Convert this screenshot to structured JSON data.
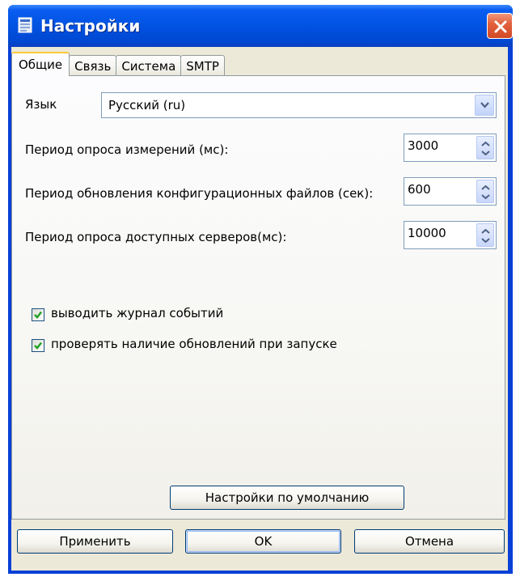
{
  "window": {
    "title": "Настройки"
  },
  "tabs": [
    {
      "label": "Общие",
      "active": true
    },
    {
      "label": "Связь",
      "active": false
    },
    {
      "label": "Система",
      "active": false
    },
    {
      "label": "SMTP",
      "active": false
    }
  ],
  "general": {
    "language_label": "Язык",
    "language_value": "Русский (ru)",
    "measure_period_label": "Период опроса измерений (мс):",
    "measure_period_value": "3000",
    "config_period_label": "Период обновления конфигурационных файлов (сек):",
    "config_period_value": "600",
    "servers_period_label": "Период опроса доступных серверов(мс):",
    "servers_period_value": "10000",
    "log_checkbox_label": "выводить журнал событий",
    "log_checkbox_checked": true,
    "updates_checkbox_label": "проверять наличие обновлений при запуске",
    "updates_checkbox_checked": true,
    "defaults_button_label": "Настройки по умолчанию"
  },
  "footer": {
    "apply_label": "Применить",
    "ok_label": "OK",
    "cancel_label": "Отмена"
  },
  "colors": {
    "titlebar": "#0054e3",
    "dialog_face": "#ece9d8",
    "close_button": "#e2623e",
    "active_tab_accent": "#ffc83c",
    "checkmark": "#21a121"
  }
}
